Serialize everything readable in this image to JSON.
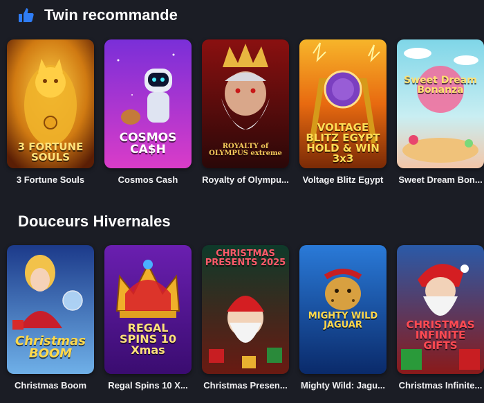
{
  "sections": [
    {
      "title": "Twin recommande",
      "icon": "thumbs-up-icon",
      "games": [
        {
          "name": "3 Fortune Souls",
          "logo": "3 FORTUNE SOULS"
        },
        {
          "name": "Cosmos Cash",
          "logo": "COSMOS CA$H"
        },
        {
          "name": "Royalty of Olympus",
          "logo": "ROYALTY of OLYMPUS extreme"
        },
        {
          "name": "Voltage Blitz Egypt",
          "logo": "VOLTAGE BLITZ EGYPT HOLD & WIN 3x3"
        },
        {
          "name": "Sweet Dream Bonanza",
          "logo": "Sweet Dream Bonanza"
        }
      ]
    },
    {
      "title": "Douceurs Hivernales",
      "games": [
        {
          "name": "Christmas Boom",
          "logo": "Christmas BOOM"
        },
        {
          "name": "Regal Spins 10 Xmas",
          "logo": "REGAL SPINS 10 Xmas"
        },
        {
          "name": "Christmas Presents 2025",
          "logo": "CHRISTMAS PRESENTS 2025"
        },
        {
          "name": "Mighty Wild: Jaguar",
          "logo": "MIGHTY WILD JAGUAR"
        },
        {
          "name": "Christmas Infinite Gifts",
          "logo": "CHRISTMAS INFINITE GIFTS"
        }
      ]
    }
  ],
  "captions": {
    "s0": [
      "3 Fortune Souls",
      "Cosmos Cash",
      "Royalty of Olympu...",
      "Voltage Blitz Egypt",
      "Sweet Dream Bon..."
    ],
    "s1": [
      "Christmas Boom",
      "Regal Spins 10 X...",
      "Christmas Presen...",
      "Mighty Wild: Jagu...",
      "Christmas Infinite..."
    ]
  },
  "colors": {
    "background": "#1b1d25",
    "thumb_icon": "#2f7df6",
    "text": "#ffffff"
  }
}
